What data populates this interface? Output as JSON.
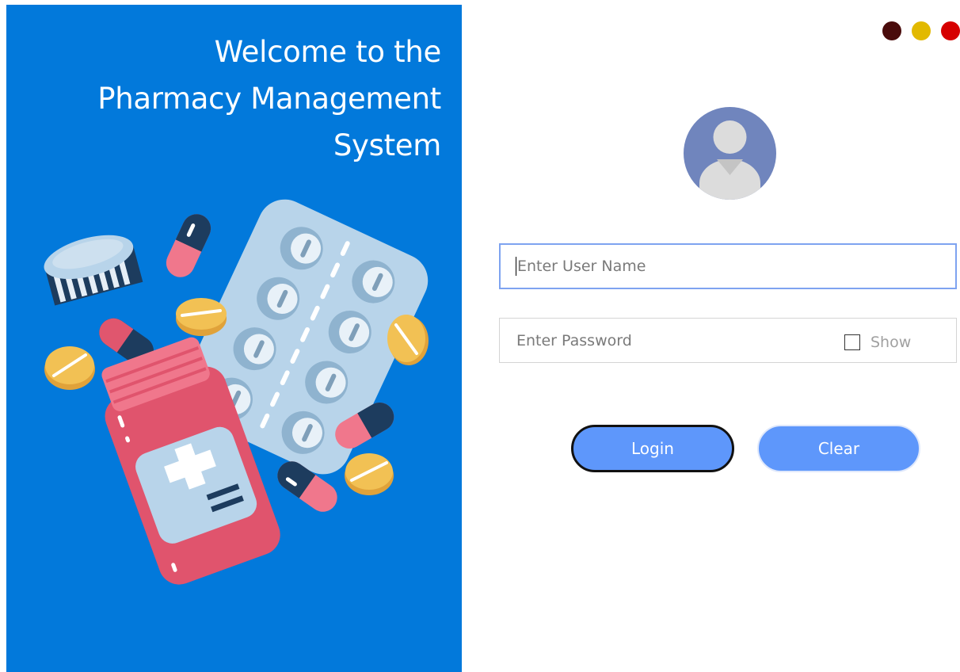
{
  "welcome": {
    "line1": "Welcome to the",
    "line2": "Pharmacy Management",
    "line3": "System"
  },
  "window_controls": [
    {
      "name": "minimize",
      "color": "#4a0c0c"
    },
    {
      "name": "maximize",
      "color": "#e2b900"
    },
    {
      "name": "close",
      "color": "#d60000"
    }
  ],
  "form": {
    "username_placeholder": "Enter User Name",
    "password_placeholder": "Enter Password",
    "show_label": "Show",
    "login_label": "Login",
    "clear_label": "Clear"
  },
  "colors": {
    "panel": "#0279db",
    "button": "#5e97fb",
    "avatar": "#7085bd"
  }
}
